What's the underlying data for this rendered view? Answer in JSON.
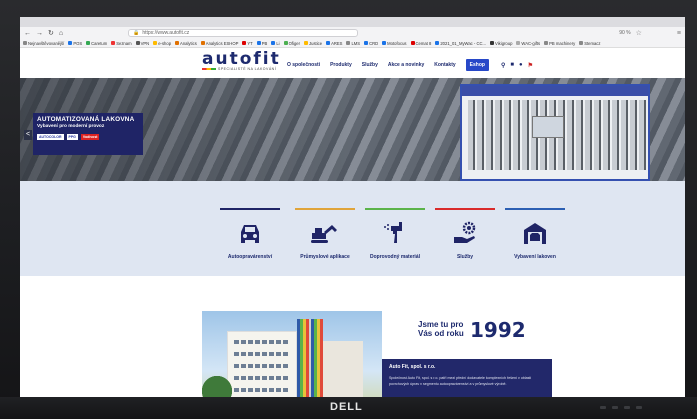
{
  "browser": {
    "url": "https://www.autofit.cz",
    "zoom": "90 %",
    "bookmarks": [
      "Nejnavštěvovanější",
      "POS",
      "Caretum",
      "Seznam",
      "VPN",
      "e-shop",
      "Analytics",
      "Analytics ESHOP",
      "YT",
      "PB",
      "Li",
      "Ofiger",
      "Justice",
      "ARES",
      "LMS",
      "CRD",
      "Motofocus",
      "Cemat 8",
      "2021_01_MyWac - CC...",
      "Vikigroup",
      "WAC-gifts",
      "PB machinery",
      "Stemacz"
    ]
  },
  "site": {
    "logo": "autofit",
    "logo_tagline": "SPECIALISTÉ NA LAKOVÁNÍ",
    "nav": [
      "O společnosti",
      "Produkty",
      "Služby",
      "Akce a novinky",
      "Kontakty"
    ],
    "eshop_label": "Eshop",
    "hero": {
      "title": "AUTOMATIZOVANÁ LAKOVNA",
      "subtitle": "Vybavení pro moderní provoz",
      "brands": [
        "AUTOCOLOR",
        "PPG",
        "Vodivost"
      ],
      "prev_arrow": "<"
    },
    "categories": [
      {
        "label": "Autoopravárenství",
        "color": "#1f2466"
      },
      {
        "label": "Průmyslové aplikace",
        "color": "#e0a43a"
      },
      {
        "label": "Doprovodný materiál",
        "color": "#5bb34a"
      },
      {
        "label": "Služby",
        "color": "#d92b2b"
      },
      {
        "label": "Vybavení lakoven",
        "color": "#2c5fb3"
      }
    ],
    "since": {
      "text_line1": "Jsme tu pro",
      "text_line2": "Vás od roku",
      "year": "1992"
    },
    "info": {
      "heading": "Auto Fit, spol. s r.o.",
      "body": "Společnost Auto Fit, spol. s r.o. patří mezi přední dodavatele komplexních řešení v oblasti povrchových úprav v segmentu autoopravárenství a v průmyslové výrobě."
    }
  },
  "monitor": {
    "brand": "DELL"
  }
}
